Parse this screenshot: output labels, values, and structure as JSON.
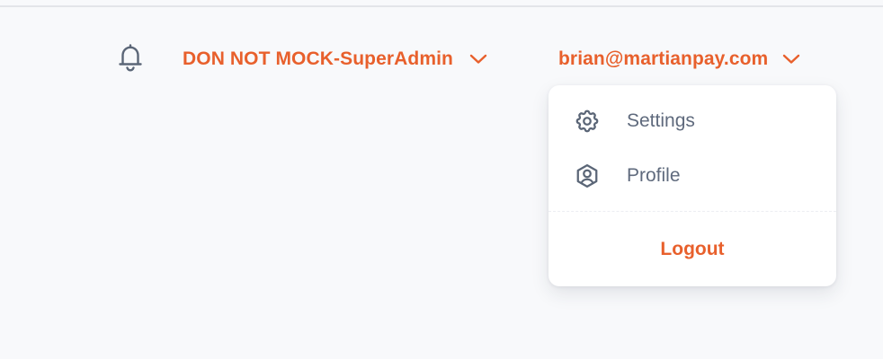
{
  "header": {
    "notifications_icon": "bell-icon",
    "organization": {
      "label": "DON NOT MOCK-SuperAdmin",
      "icon": "chevron-down-icon"
    },
    "user": {
      "email": "brian@martianpay.com",
      "icon": "chevron-down-icon"
    }
  },
  "user_menu": {
    "items": [
      {
        "label": "Settings",
        "icon": "gear-icon"
      },
      {
        "label": "Profile",
        "icon": "user-circle-icon"
      }
    ],
    "logout_label": "Logout"
  },
  "colors": {
    "accent": "#e8602c",
    "text_muted": "#5f6a7d",
    "icon": "#5b6677",
    "background": "#f8f9fb",
    "surface": "#ffffff"
  }
}
